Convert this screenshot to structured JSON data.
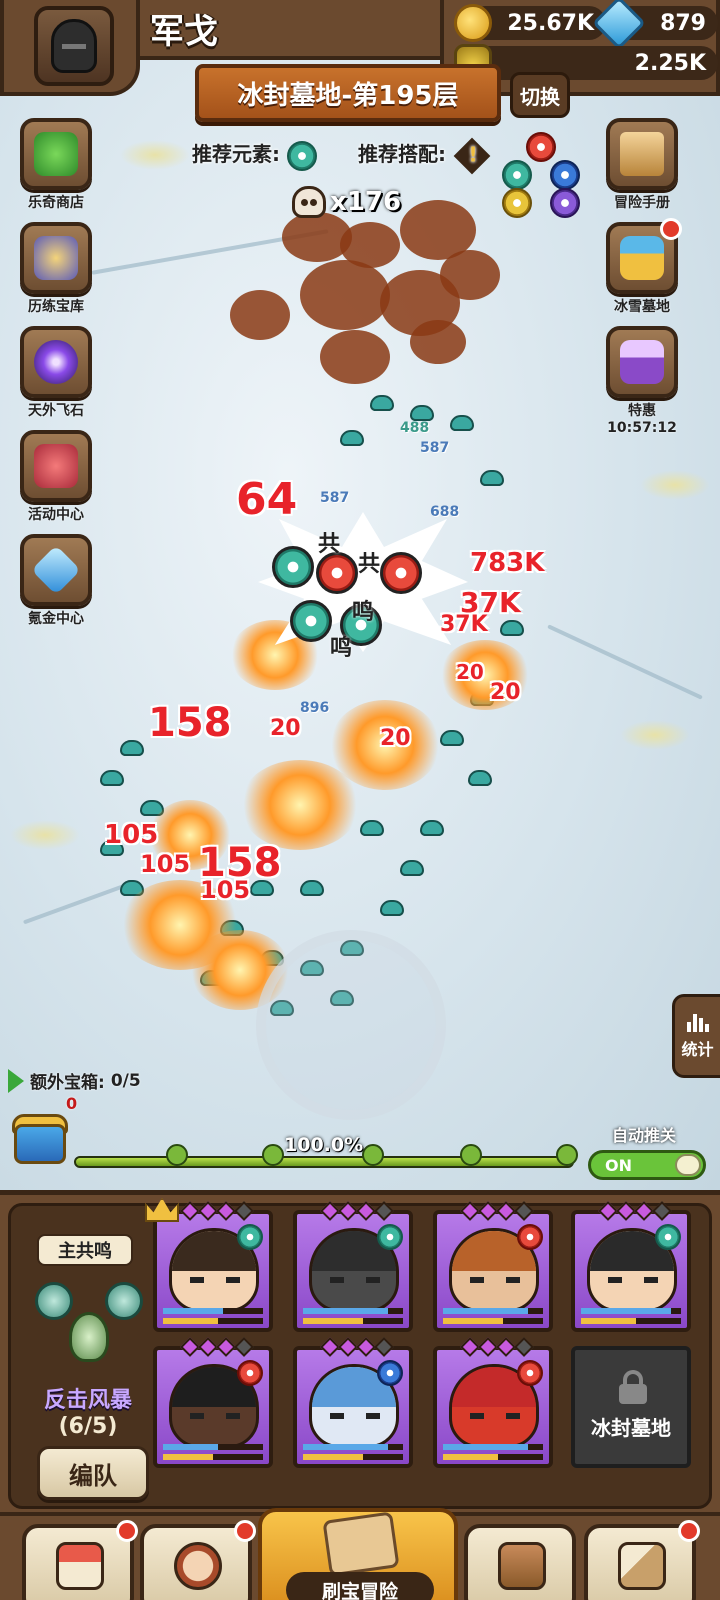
{
  "player": {
    "name": "军戈"
  },
  "resources": {
    "coins": "25.67K",
    "gems": "879",
    "potions": "2.25K"
  },
  "stage": {
    "title": "冰封墓地-第195层",
    "switch_label": "切换"
  },
  "recommend": {
    "element_label": "推荐元素:",
    "combo_label": "推荐搭配:"
  },
  "kills": {
    "count": "x176"
  },
  "side_left": [
    {
      "label": "乐奇商店",
      "icon": "clover-icon"
    },
    {
      "label": "历练宝库",
      "icon": "treasure-book-icon"
    },
    {
      "label": "天外飞石",
      "icon": "portal-icon"
    },
    {
      "label": "活动中心",
      "icon": "bouquet-icon"
    },
    {
      "label": "氪金中心",
      "icon": "diamond-icon"
    }
  ],
  "side_right": [
    {
      "label": "冒险手册",
      "icon": "scroll-icon"
    },
    {
      "label": "冰雪墓地",
      "icon": "chest-icon"
    },
    {
      "label": "特惠",
      "sub": "10:57:12",
      "icon": "gift-chest-icon"
    }
  ],
  "combat": {
    "damage_numbers": [
      "64",
      "158",
      "158",
      "105",
      "105",
      "105",
      "20",
      "20",
      "20",
      "20",
      "783K",
      "37K",
      "37K",
      "587",
      "587",
      "688",
      "896",
      "488"
    ],
    "combo_words": [
      "共",
      "共",
      "鸣",
      "鸣"
    ]
  },
  "stats_label": "统计",
  "extra_chest": {
    "label": "额外宝箱:",
    "progress": "0/5",
    "count": "0"
  },
  "progress": {
    "percent": "100.0%",
    "value": 1.0
  },
  "auto_push": {
    "label": "自动推关",
    "state": "ON"
  },
  "team": {
    "main_synergy_title": "主共鸣",
    "synergy_name": "反击风暴",
    "synergy_count": "(6/5)",
    "formation_button": "编队",
    "locked_slot_label": "冰封墓地"
  },
  "heroes": [
    {
      "stars": 3,
      "element": "wind",
      "hp": 0.6,
      "xp": 0.55
    },
    {
      "stars": 3,
      "element": "wind",
      "hp": 0.85,
      "xp": 0.6
    },
    {
      "stars": 3,
      "element": "fire",
      "hp": 0.85,
      "xp": 0.6
    },
    {
      "stars": 3,
      "element": "wind",
      "hp": 0.9,
      "xp": 0.55
    },
    {
      "stars": 3,
      "element": "fire",
      "hp": 0.55,
      "xp": 0.5
    },
    {
      "stars": 3,
      "element": "water",
      "hp": 0.85,
      "xp": 0.6
    },
    {
      "stars": 3,
      "element": "fire",
      "hp": 0.85,
      "xp": 0.55
    }
  ],
  "bottom_nav": {
    "main_label": "刷宝冒险"
  },
  "colors": {
    "panel_brown": "#6b4a2f",
    "hero_card_purple": "#9a5ad8",
    "toggle_green": "#6ac43a",
    "damage_red": "#e8232a"
  }
}
